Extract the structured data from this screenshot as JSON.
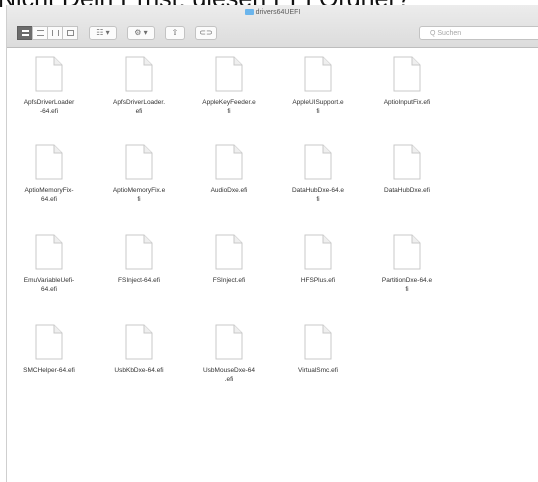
{
  "caption": "Nicht Dein Ernst: diesen EFI Ordner?",
  "window": {
    "title": "drivers64UEFI",
    "title_icon": "folder-icon",
    "accent": "#6bb5ec"
  },
  "toolbar": {
    "view_mode_selected": "icon-view",
    "arrange_glyph": "⚙ ▾",
    "group_glyph": "☷ ▾",
    "share_glyph": "⇧",
    "tag_glyph": "⊂⊃"
  },
  "search": {
    "placeholder": "Q Suchen",
    "icon": "search-icon",
    "label": "Suchen"
  },
  "files": [
    [
      "ApfsDriverLoader",
      "-64.efi"
    ],
    [
      "ApfsDriverLoader.",
      "efi"
    ],
    [
      "AppleKeyFeeder.e",
      "fi"
    ],
    [
      "AppleUISupport.e",
      "fi"
    ],
    [
      "AptioInputFix.efi"
    ],
    [
      "AptioMemoryFix-",
      "64.efi"
    ],
    [
      "AptioMemoryFix.e",
      "fi"
    ],
    [
      "AudioDxe.efi"
    ],
    [
      "DataHubDxe-64.e",
      "fi"
    ],
    [
      "DataHubDxe.efi"
    ],
    [
      "EmuVariableUefi-",
      "64.efi"
    ],
    [
      "FSInject-64.efi"
    ],
    [
      "FSInject.efi"
    ],
    [
      "HFSPlus.efi"
    ],
    [
      "PartitionDxe-64.e",
      "fi"
    ],
    [
      "SMCHelper-64.efi"
    ],
    [
      "UsbKbDxe-64.efi"
    ],
    [
      "UsbMouseDxe-64",
      ".efi"
    ],
    [
      "VirtualSmc.efi"
    ]
  ]
}
